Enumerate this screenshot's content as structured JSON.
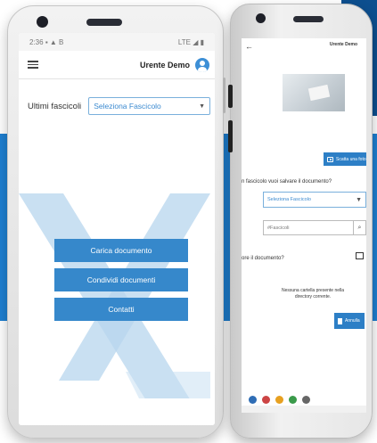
{
  "phone1": {
    "status": {
      "time": "2:36",
      "icons_left": "▪ ▲ B",
      "network": "LTE ◢ ▮"
    },
    "header": {
      "user_name": "Urente Demo"
    },
    "recent": {
      "label": "Ultimi fascicoli",
      "select_value": "Seleziona Fascicolo"
    },
    "actions": [
      "Carica documento",
      "Condividi documenti",
      "Contatti"
    ]
  },
  "phone2": {
    "header": {
      "user_name": "Urente Demo"
    },
    "take_photo_label": "Scatta una foto",
    "question_folder": "n fascicolo vuoi salvare il documento?",
    "select_value": "Seleziona Fascicolo",
    "search_placeholder": "#Fascicoli",
    "question_document": "ore il documento?",
    "empty_message": "Nessuna cartella presente nella directory corrente.",
    "cancel_label": "Annulla"
  },
  "colors": {
    "brand_blue": "#3688cb",
    "band_blue": "#1e7fd1",
    "logo_light_blue": "#b7d6ee"
  }
}
